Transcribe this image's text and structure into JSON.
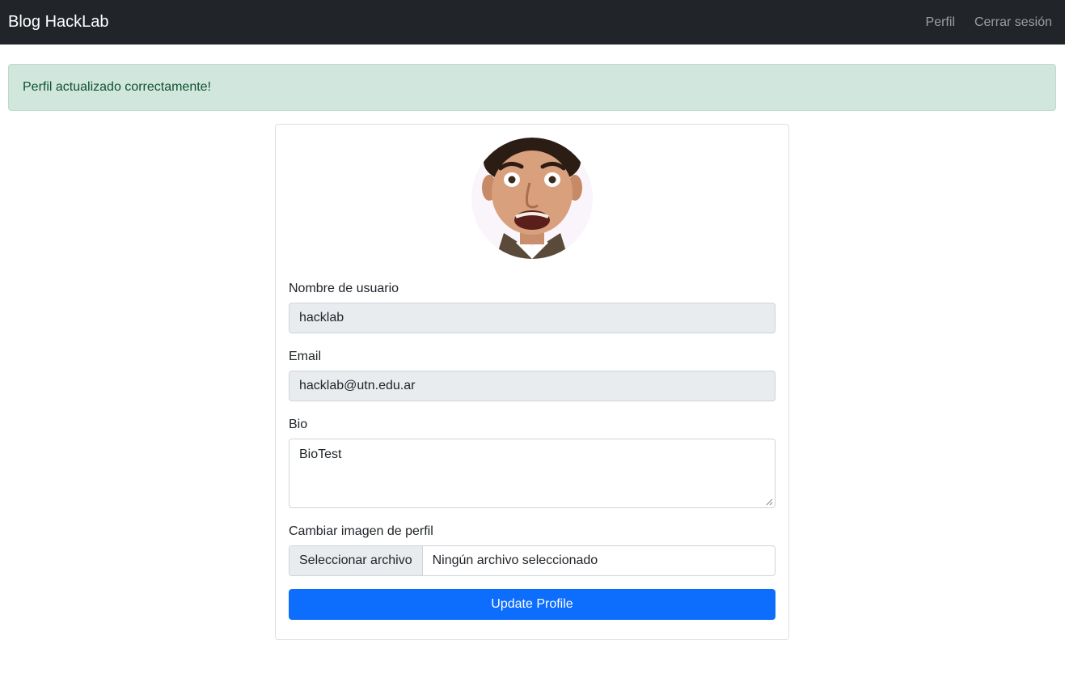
{
  "navbar": {
    "brand": "Blog HackLab",
    "links": [
      {
        "label": "Perfil"
      },
      {
        "label": "Cerrar sesión"
      }
    ]
  },
  "alert": {
    "message": "Perfil actualizado correctamente!",
    "status_color": "#d1e7dd"
  },
  "profile_form": {
    "username": {
      "label": "Nombre de usuario",
      "value": "hacklab"
    },
    "email": {
      "label": "Email",
      "value": "hacklab@utn.edu.ar"
    },
    "bio": {
      "label": "Bio",
      "value": "BioTest"
    },
    "image": {
      "label": "Cambiar imagen de perfil",
      "button_label": "Seleccionar archivo",
      "file_status": "Ningún archivo seleccionado"
    },
    "submit_label": "Update Profile",
    "accent_color": "#0d6efd"
  }
}
